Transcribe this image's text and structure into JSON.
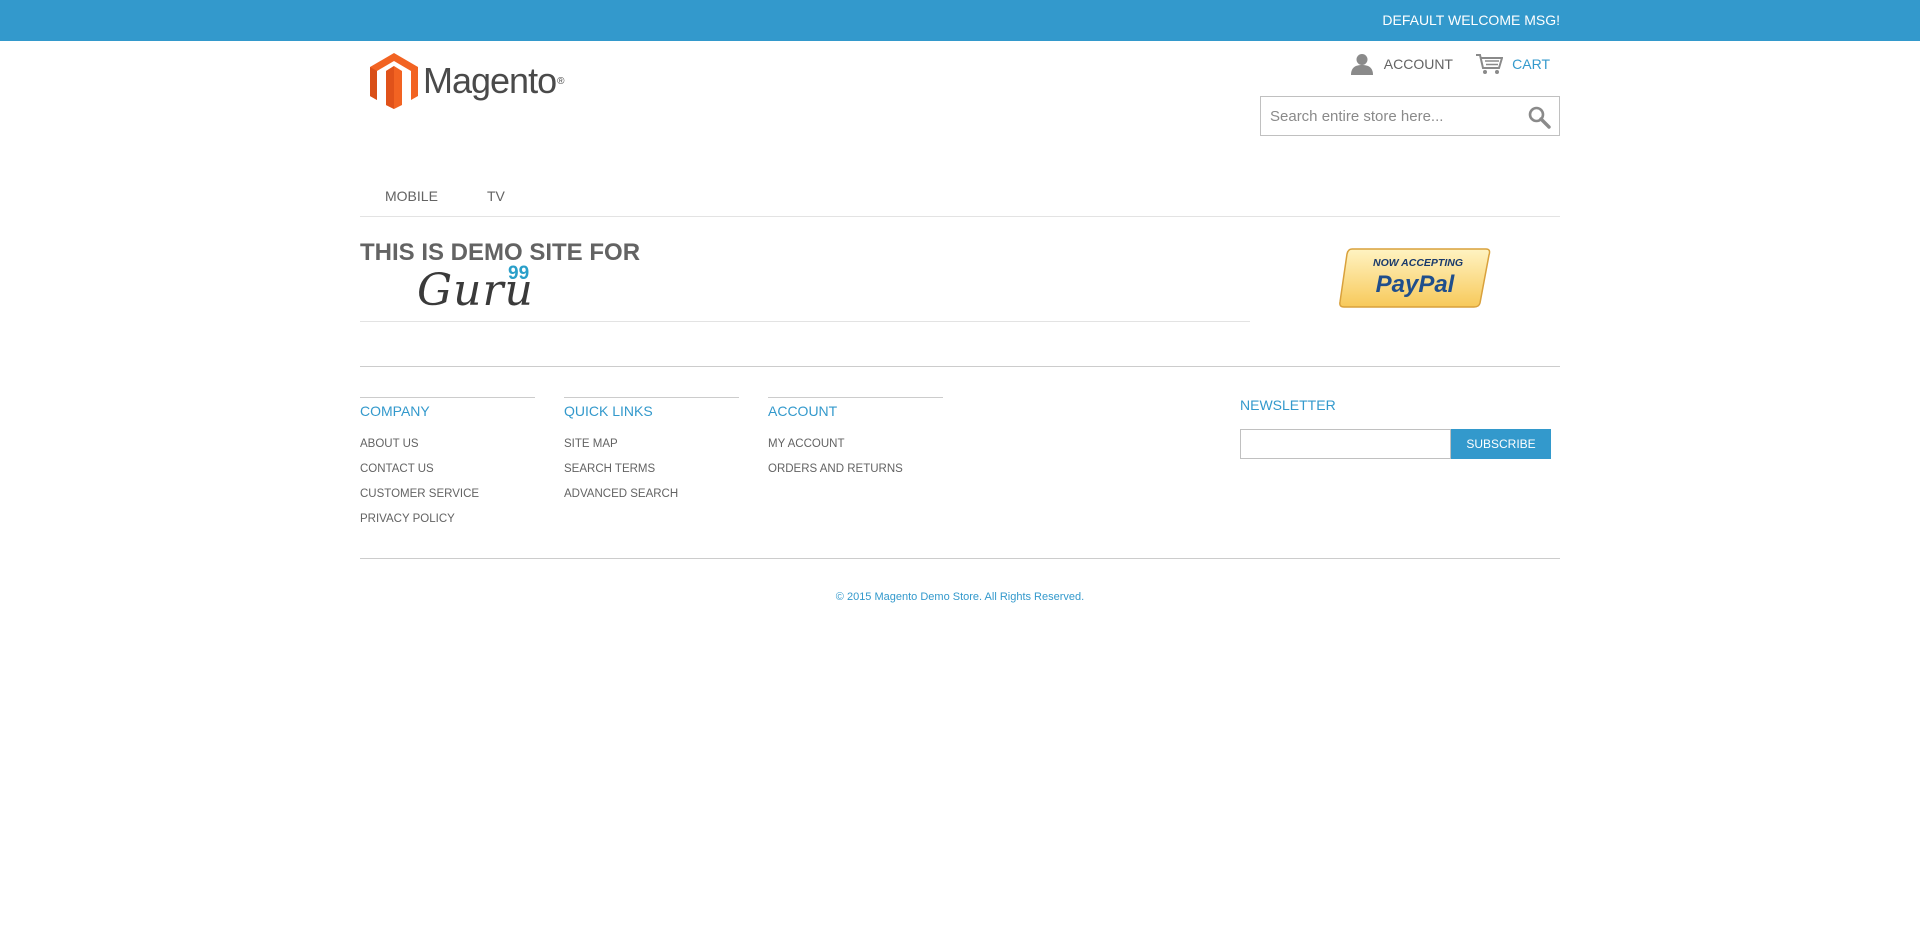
{
  "welcome_bar": {
    "message": "DEFAULT WELCOME MSG!"
  },
  "header": {
    "logo_text": "Magento",
    "logo_reg": "®",
    "account_label": "ACCOUNT",
    "cart_label": "CART",
    "search_placeholder": "Search entire store here...",
    "icons": {
      "account": "user-icon",
      "cart": "cart-icon",
      "search": "search-icon"
    }
  },
  "nav": {
    "items": [
      {
        "label": "MOBILE"
      },
      {
        "label": "TV"
      }
    ]
  },
  "promo": {
    "heading": "THIS IS DEMO SITE FOR",
    "guru_word": "Guru",
    "guru_sup": "99",
    "paypal_top": "NOW ACCEPTING",
    "paypal_brand": "PayPal"
  },
  "footer": {
    "columns": [
      {
        "title": "COMPANY",
        "links": [
          "ABOUT US",
          "CONTACT US",
          "CUSTOMER SERVICE",
          "PRIVACY POLICY"
        ]
      },
      {
        "title": "QUICK LINKS",
        "links": [
          "SITE MAP",
          "SEARCH TERMS",
          "ADVANCED SEARCH"
        ]
      },
      {
        "title": "ACCOUNT",
        "links": [
          "MY ACCOUNT",
          "ORDERS AND RETURNS"
        ]
      }
    ],
    "newsletter": {
      "title": "NEWSLETTER",
      "input_value": "",
      "button_label": "SUBSCRIBE"
    },
    "copyright": "© 2015 Magento Demo Store. All Rights Reserved."
  },
  "colors": {
    "accent": "#3399cc",
    "text": "#636363",
    "logo_orange": "#f26322"
  }
}
